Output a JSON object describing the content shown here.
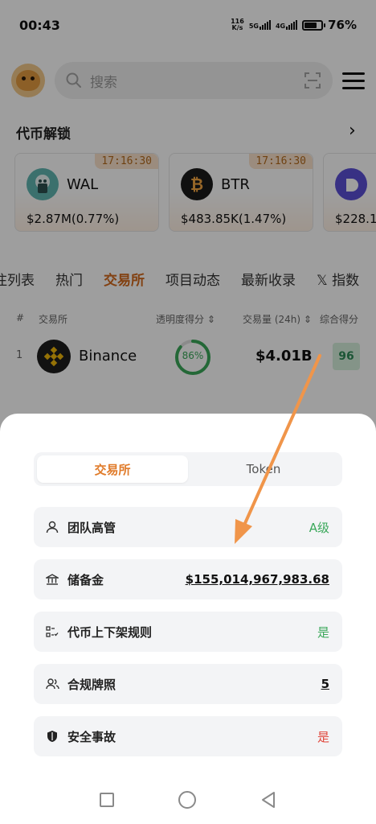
{
  "status_bar": {
    "time": "00:43",
    "net_speed_top": "116",
    "net_speed_bottom": "K/s",
    "sig1_label": "5G",
    "sig2_label": "4G",
    "battery": "76%",
    "battery_level": 0.76
  },
  "header": {
    "search_placeholder": "搜索",
    "avatar_icon": "tiger-avatar",
    "menu_icon": "hamburger-menu-icon"
  },
  "unlock": {
    "title": "代币解锁",
    "arrow": "›",
    "cards": [
      {
        "symbol": "WAL",
        "timer": "17:16:30",
        "value": "$2.87M(0.77%)",
        "logo_color": "#5fb5b1"
      },
      {
        "symbol": "BTR",
        "timer": "17:16:30",
        "value": "$483.85K(1.47%)",
        "logo_color": "#1b1b1b"
      },
      {
        "symbol": "",
        "timer": "",
        "value": "$228.1",
        "logo_color": "#5b4fd6"
      }
    ]
  },
  "tabs": [
    {
      "label": "注列表"
    },
    {
      "label": "热门"
    },
    {
      "label": "交易所",
      "active": true
    },
    {
      "label": "项目动态"
    },
    {
      "label": "最新收录"
    },
    {
      "label": "𝕏 指数"
    }
  ],
  "table": {
    "headers": {
      "index": "#",
      "exchange": "交易所",
      "transparency": "透明度得分 ⇕",
      "volume": "交易量 (24h) ⇕",
      "score": "综合得分"
    },
    "rows": [
      {
        "index": "1",
        "name": "Binance",
        "transparency": "86%",
        "transparency_value": 0.86,
        "volume": "$4.01B",
        "score": "96"
      }
    ]
  },
  "sheet": {
    "segments": [
      {
        "label": "交易所",
        "active": true
      },
      {
        "label": "Token",
        "active": false
      }
    ],
    "items": [
      {
        "label": "团队高管",
        "value": "A级",
        "style": "green",
        "icon": "person-icon"
      },
      {
        "label": "储备金",
        "value": "$155,014,967,983.68",
        "style": "ul",
        "icon": "bank-icon"
      },
      {
        "label": "代币上下架规则",
        "value": "是",
        "style": "green",
        "icon": "list-check-icon"
      },
      {
        "label": "合规牌照",
        "value": "5",
        "style": "ul",
        "icon": "group-icon"
      },
      {
        "label": "安全事故",
        "value": "是",
        "style": "red",
        "icon": "shield-icon"
      }
    ]
  },
  "colors": {
    "accent": "#d2691e",
    "green": "#3aa85a",
    "red": "#e0453a",
    "annotation_arrow": "#f0954a"
  }
}
